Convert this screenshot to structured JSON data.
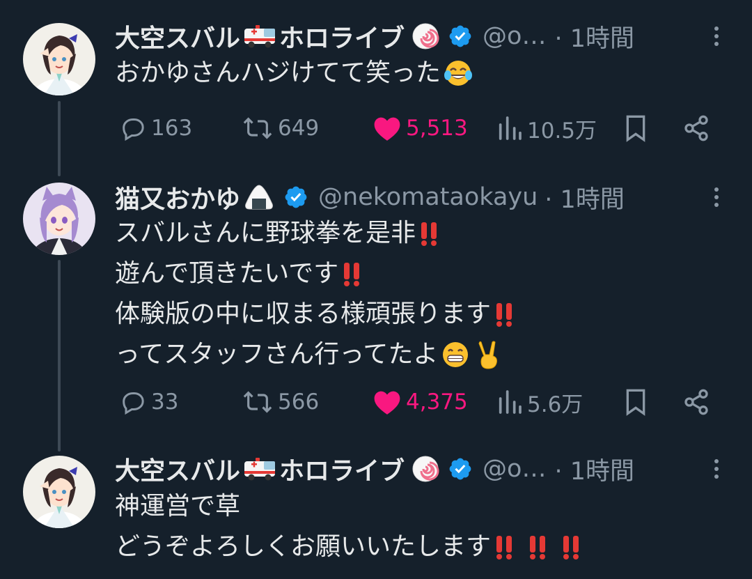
{
  "tweets": [
    {
      "name": "大空スバル",
      "name_suffix": "ホロライブ",
      "handle": "@o…",
      "time": "· 1時間",
      "lines": [
        "おかゆさんハジけてて笑った"
      ],
      "replies": "163",
      "retweets": "649",
      "likes": "5,513",
      "views": "10.5万"
    },
    {
      "name": "猫又おかゆ",
      "handle": "@nekomataokayu",
      "time": "· 1時間",
      "lines": [
        "スバルさんに野球拳を是非",
        "遊んで頂きたいです",
        "体験版の中に収まる様頑張ります",
        "ってスタッフさん行ってたよ"
      ],
      "replies": "33",
      "retweets": "566",
      "likes": "4,375",
      "views": "5.6万"
    },
    {
      "name": "大空スバル",
      "name_suffix": "ホロライブ",
      "handle": "@o…",
      "time": "· 1時間",
      "lines": [
        "神運営で草",
        "どうぞよろしくお願いいたします"
      ]
    }
  ],
  "colors": {
    "background": "#15202b",
    "text": "#e7e9ea",
    "secondary": "#8b98a5",
    "like": "#f91880",
    "verified": "#1d9bf0"
  },
  "icons": [
    "reply-icon",
    "retweet-icon",
    "heart-icon",
    "views-icon",
    "bookmark-icon",
    "share-icon",
    "verified-badge-icon",
    "more-icon"
  ]
}
